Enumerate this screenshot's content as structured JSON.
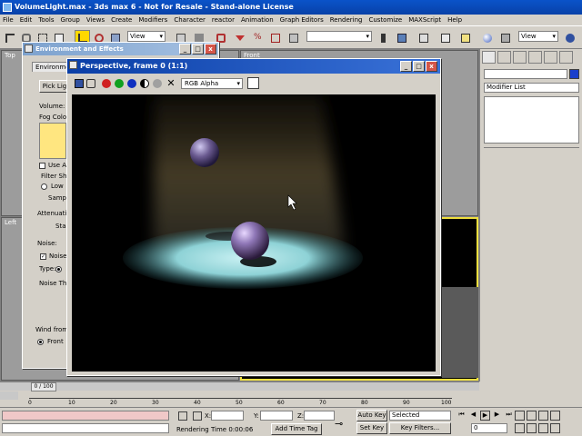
{
  "window": {
    "title": "VolumeLight.max - 3ds max 6 - Not for Resale - Stand-alone License"
  },
  "menu": [
    "File",
    "Edit",
    "Tools",
    "Group",
    "Views",
    "Create",
    "Modifiers",
    "Character",
    "reactor",
    "Animation",
    "Graph Editors",
    "Rendering",
    "Customize",
    "MAXScript",
    "Help"
  ],
  "toolbar": {
    "view_dropdown": "View",
    "view_dropdown_right": "View"
  },
  "viewports": {
    "top": "Top",
    "front": "Front",
    "left": "Left"
  },
  "command_panel": {
    "modifier_list": "Modifier List"
  },
  "env_dialog": {
    "title": "Environment and Effects",
    "tab": "Environmen",
    "pick_light": "Pick Lig",
    "volume": "Volume:",
    "fog_color": "Fog Color",
    "fog_color_hex": "#ffe680",
    "use_atten": "Use A",
    "filter_shadows": "Filter Sha",
    "low": "Low",
    "sample": "Sampl",
    "attenuation": "Attenuatio",
    "start": "Sta",
    "noise": "Noise:",
    "noise_on": "Noise",
    "type": "Type:",
    "noise_threshold": "Noise Th",
    "wind_from": "Wind from",
    "front": "Front"
  },
  "render_window": {
    "title": "Perspective, frame 0 (1:1)",
    "channel": "RGB Alpha"
  },
  "timeline": {
    "slider": "0 / 100",
    "ticks": [
      "0",
      "10",
      "20",
      "30",
      "40",
      "50",
      "60",
      "70",
      "80",
      "90",
      "100"
    ]
  },
  "status": {
    "x_label": "X:",
    "y_label": "Y:",
    "z_label": "Z:",
    "rendering_time": "Rendering Time  0:00:06",
    "add_time_tag": "Add Time Tag",
    "auto_key": "Auto Key",
    "set_key": "Set Key",
    "selected": "Selected",
    "key_filters": "Key Filters...",
    "frame": "0"
  }
}
